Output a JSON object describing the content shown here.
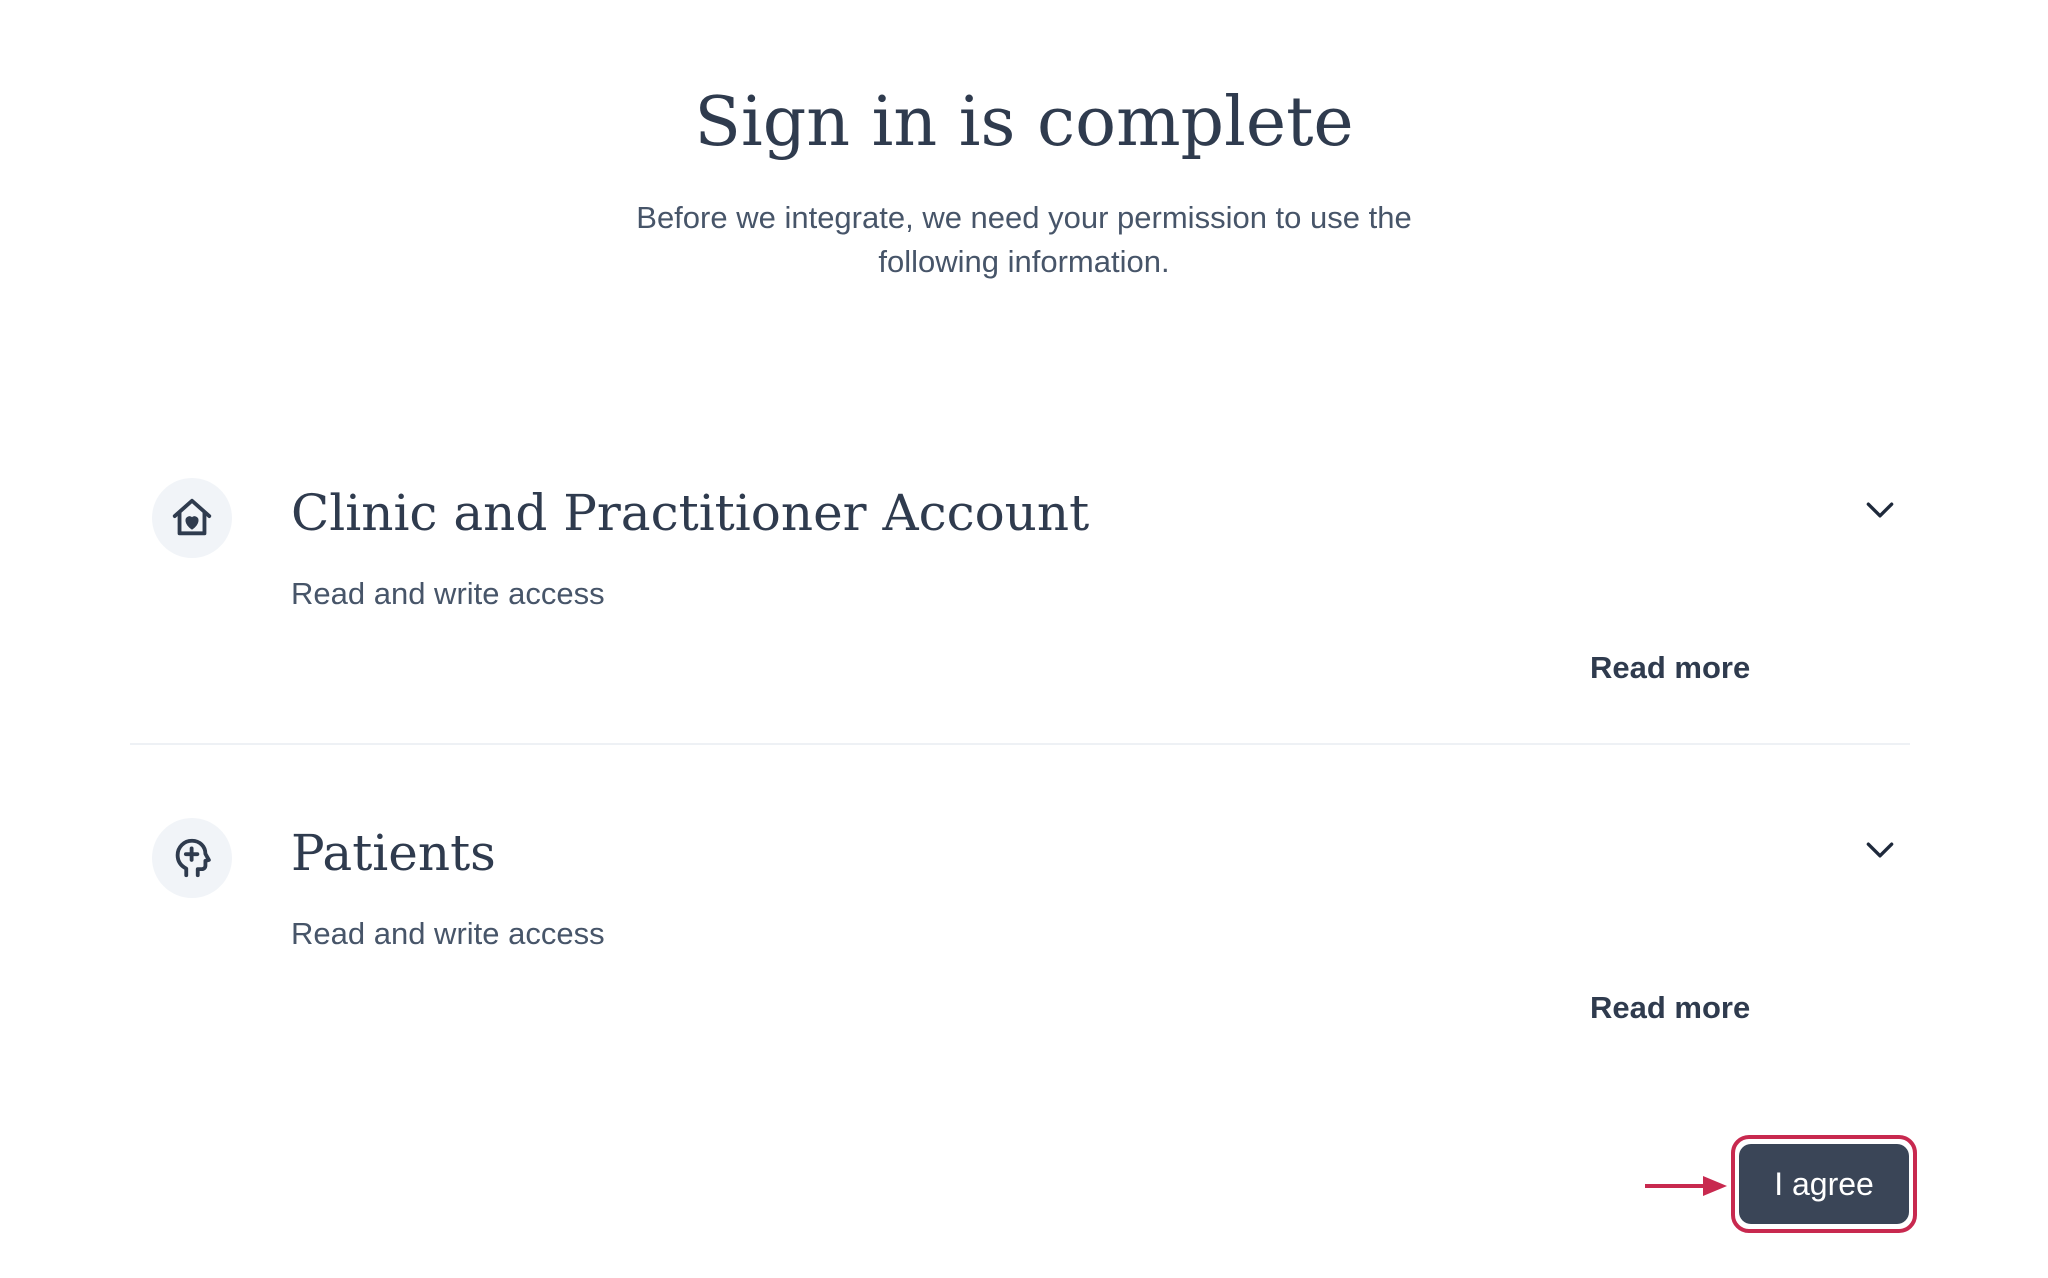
{
  "page": {
    "title": "Sign in is complete",
    "subtitle": "Before we integrate, we need your permission to use the following information."
  },
  "sections": [
    {
      "icon": "house-heart-icon",
      "title": "Clinic and Practitioner Account",
      "description": "Read and write access",
      "read_more": "Read more"
    },
    {
      "icon": "head-plus-icon",
      "title": "Patients",
      "description": "Read and write access",
      "read_more": "Read more"
    }
  ],
  "actions": {
    "agree_label": "I agree"
  },
  "colors": {
    "text_dark": "#2f3b4e",
    "button_bg": "#3a4557",
    "highlight": "#c8294f"
  }
}
